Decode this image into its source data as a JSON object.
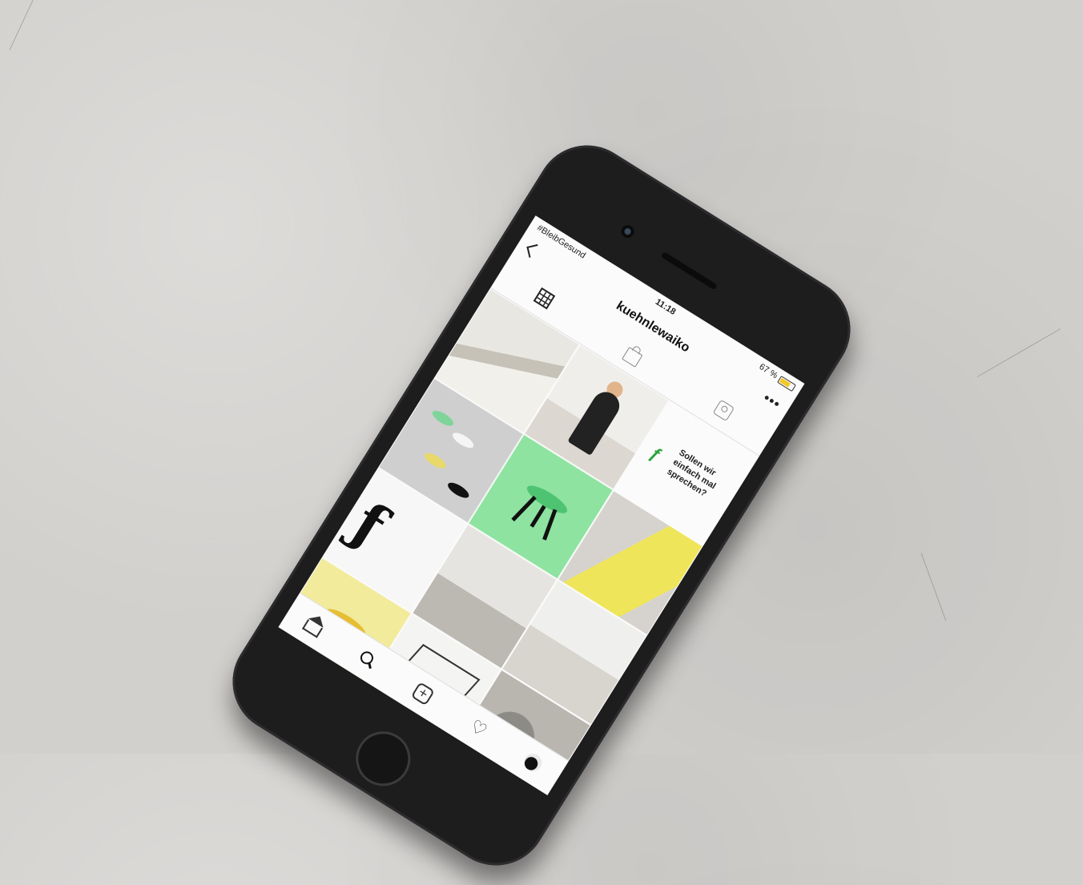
{
  "status_bar": {
    "carrier": "#BleibGesund",
    "time": "11:18",
    "battery": "67 %"
  },
  "profile": {
    "username": "kuehnlewaiko"
  },
  "tabs": [
    {
      "name": "grid",
      "icon": "grid-icon"
    },
    {
      "name": "shop",
      "icon": "shopping-bag-icon"
    },
    {
      "name": "tagged",
      "icon": "tagged-person-icon"
    }
  ],
  "posts": {
    "cta_text": "Sollen wir einfach mal sprechen?",
    "logo_mark": "ƒ"
  },
  "bottom_nav": [
    {
      "name": "home",
      "icon": "home-icon"
    },
    {
      "name": "search",
      "icon": "search-icon"
    },
    {
      "name": "add",
      "icon": "add-post-icon"
    },
    {
      "name": "activity",
      "icon": "heart-icon"
    },
    {
      "name": "profile",
      "icon": "profile-avatar-icon"
    }
  ],
  "colors": {
    "green_tile": "#8ee3a1",
    "yellow_tile": "#f1eb9b",
    "brand_green": "#2aa43a"
  }
}
